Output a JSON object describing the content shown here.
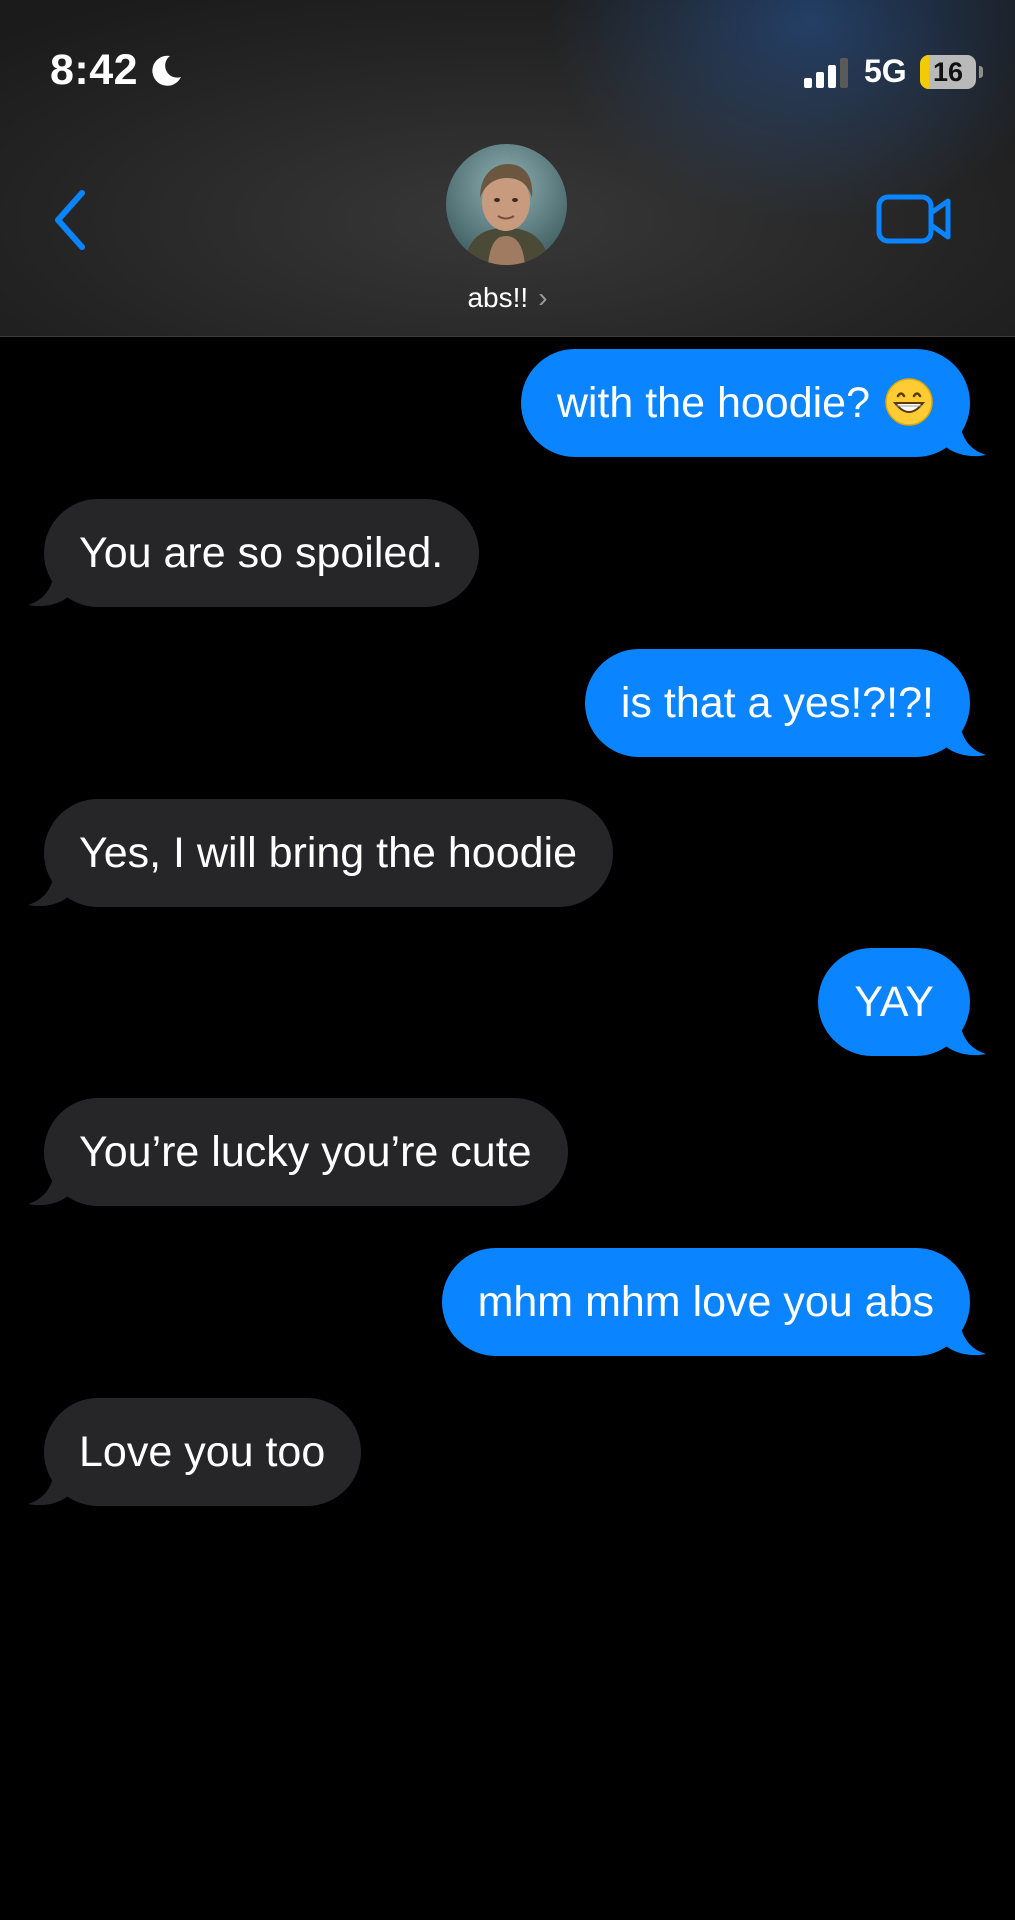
{
  "status_bar": {
    "time": "8:42",
    "network": "5G",
    "battery_percent": "16",
    "battery_level": 0.16,
    "icons": [
      "moon-icon",
      "signal-icon"
    ]
  },
  "header": {
    "contact_name": "abs!!",
    "chevron": "›",
    "back_icon": "chevron-left-icon",
    "video_icon": "video-camera-icon"
  },
  "colors": {
    "accent": "#0b84ff",
    "sent_bubble": "#0b84ff",
    "received_bubble": "#262628",
    "battery_fill": "#f2cb06",
    "background": "#000000"
  },
  "messages": [
    {
      "direction": "sent",
      "text": "with the hoodie?",
      "emoji": "grinning-face-emoji"
    },
    {
      "direction": "received",
      "text": "You are so spoiled."
    },
    {
      "direction": "sent",
      "text": "is that a yes!?!?!"
    },
    {
      "direction": "received",
      "text": "Yes, I will bring the hoodie"
    },
    {
      "direction": "sent",
      "text": "YAY"
    },
    {
      "direction": "received",
      "text": "You’re lucky you’re cute"
    },
    {
      "direction": "sent",
      "text": "mhm mhm love you abs"
    },
    {
      "direction": "received",
      "text": "Love you too"
    }
  ]
}
